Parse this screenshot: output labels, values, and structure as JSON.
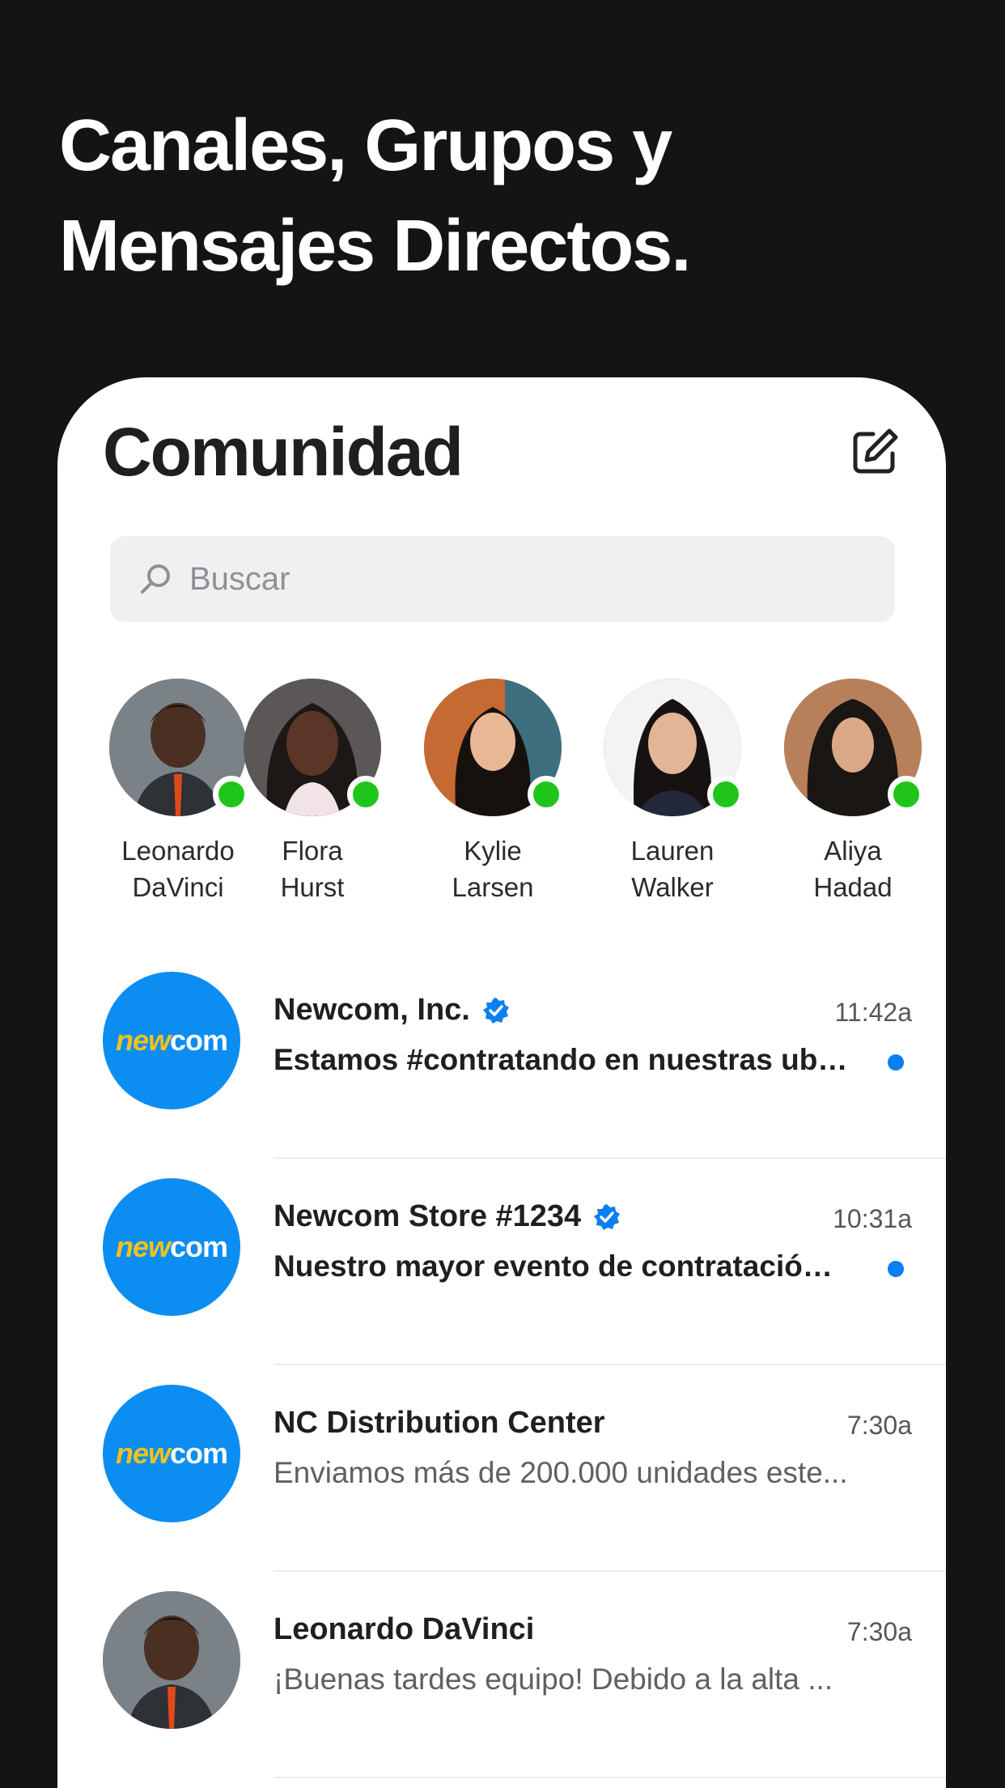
{
  "headline": "Canales, Grupos y Mensajes Directos.",
  "screen": {
    "title": "Comunidad",
    "compose_icon": "compose-icon",
    "search": {
      "placeholder": "Buscar",
      "icon": "search-icon"
    }
  },
  "stories": [
    {
      "first": "Leonardo",
      "last": "DaVinci",
      "online": true
    },
    {
      "first": "Flora",
      "last": "Hurst",
      "online": true
    },
    {
      "first": "Kylie",
      "last": "Larsen",
      "online": true
    },
    {
      "first": "Lauren",
      "last": "Walker",
      "online": true
    },
    {
      "first": "Aliya",
      "last": "Hadad",
      "online": true
    }
  ],
  "chats": [
    {
      "name": "Newcom, Inc.",
      "verified": true,
      "time": "11:42a",
      "message": "Estamos #contratando en nuestras ubicaciones",
      "unread": true,
      "avatar": "newcom"
    },
    {
      "name": "Newcom Store #1234",
      "verified": true,
      "time": "10:31a",
      "message": "Nuestro mayor evento de contratación del año",
      "unread": true,
      "avatar": "newcom"
    },
    {
      "name": "NC Distribution Center",
      "verified": false,
      "time": "7:30a",
      "message": "Enviamos más de 200.000 unidades este...",
      "unread": false,
      "avatar": "newcom"
    },
    {
      "name": "Leonardo DaVinci",
      "verified": false,
      "time": "7:30a",
      "message": "¡Buenas tardes equipo! Debido a la alta ...",
      "unread": false,
      "avatar": "person"
    }
  ],
  "logo": {
    "part1": "new",
    "part2": "com"
  },
  "colors": {
    "background": "#131416",
    "accent": "#0b8df2",
    "online": "#20c51c",
    "logo_yellow": "#f2c21a"
  }
}
